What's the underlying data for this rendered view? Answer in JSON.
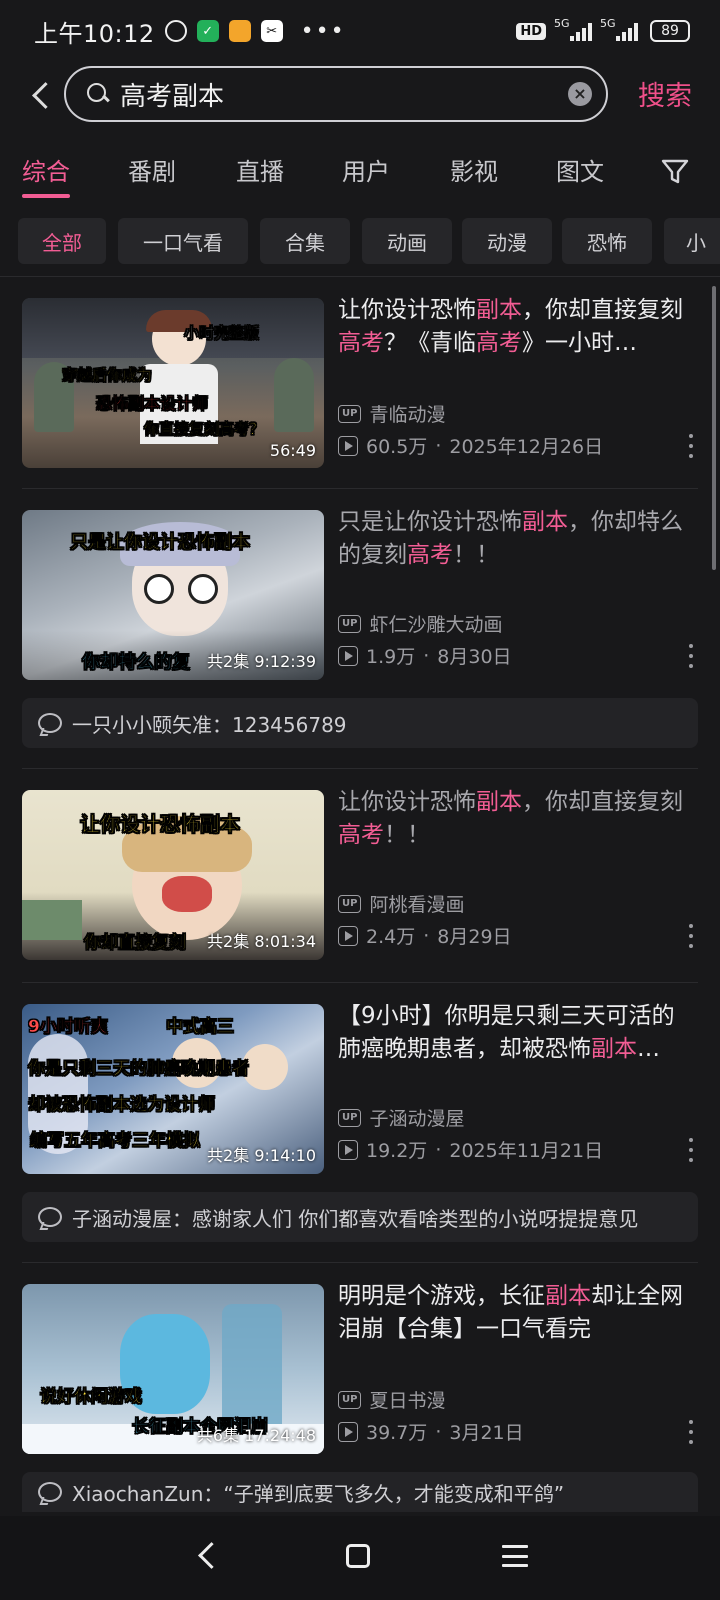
{
  "status_bar": {
    "time": "上午10:12",
    "battery": "89",
    "network_1": "5G",
    "network_2": "5G",
    "hd_badge": "HD",
    "icons": [
      "alarm-icon",
      "shield-app-icon",
      "notes-app-icon",
      "capcut-app-icon",
      "more-dots-icon",
      "signal-icon",
      "battery-icon"
    ]
  },
  "search": {
    "query": "高考副本",
    "search_button": "搜索"
  },
  "tabs": [
    {
      "label": "综合",
      "active": true
    },
    {
      "label": "番剧",
      "active": false
    },
    {
      "label": "直播",
      "active": false
    },
    {
      "label": "用户",
      "active": false
    },
    {
      "label": "影视",
      "active": false
    },
    {
      "label": "图文",
      "active": false
    }
  ],
  "chips": [
    {
      "label": "全部",
      "active": true
    },
    {
      "label": "一口气看",
      "active": false
    },
    {
      "label": "合集",
      "active": false
    },
    {
      "label": "动画",
      "active": false
    },
    {
      "label": "动漫",
      "active": false
    },
    {
      "label": "恐怖",
      "active": false
    },
    {
      "label": "小",
      "active": false
    }
  ],
  "accent_color": "#f25d94",
  "results": [
    {
      "title_parts": [
        {
          "t": "让你设计恐怖",
          "hl": false
        },
        {
          "t": "副本",
          "hl": true
        },
        {
          "t": "，你却直接复刻",
          "hl": false
        },
        {
          "t": "高考",
          "hl": true
        },
        {
          "t": "？《青临",
          "hl": false
        },
        {
          "t": "高考",
          "hl": true
        },
        {
          "t": "》一小时…",
          "hl": false
        }
      ],
      "watched": false,
      "uploader": "青临动漫",
      "views": "60.5万",
      "date": "2025年12月26日",
      "duration": "56:49",
      "episodes": "",
      "thumb_captions": [
        "小时完整版",
        "穿越后你成为",
        "恐怖副本设计师",
        "你直接复刻高考？"
      ],
      "comment": ""
    },
    {
      "title_parts": [
        {
          "t": "只是让你设计恐怖",
          "hl": false
        },
        {
          "t": "副本",
          "hl": true
        },
        {
          "t": "，你却特么的复刻",
          "hl": false
        },
        {
          "t": "高考",
          "hl": true
        },
        {
          "t": "！！",
          "hl": false
        }
      ],
      "watched": true,
      "uploader": "虾仁沙雕大动画",
      "views": "1.9万",
      "date": "8月30日",
      "duration": "9:12:39",
      "episodes": "共2集",
      "thumb_captions": [
        "只是让你设计恐怖副本",
        "你却特么的复"
      ],
      "comment": "一只小小颐矢准：123456789"
    },
    {
      "title_parts": [
        {
          "t": "让你设计恐怖",
          "hl": false
        },
        {
          "t": "副本",
          "hl": true
        },
        {
          "t": "，你却直接复刻",
          "hl": false
        },
        {
          "t": "高考",
          "hl": true
        },
        {
          "t": "！！",
          "hl": false
        }
      ],
      "watched": true,
      "uploader": "阿桃看漫画",
      "views": "2.4万",
      "date": "8月29日",
      "duration": "8:01:34",
      "episodes": "共2集",
      "thumb_captions": [
        "让你设计恐怖副本",
        "你却直接复刻"
      ],
      "comment": ""
    },
    {
      "title_parts": [
        {
          "t": "【9小时】你明是只剩三天可活的肺癌晚期患者，却被恐怖",
          "hl": false
        },
        {
          "t": "副本",
          "hl": true
        },
        {
          "t": "…",
          "hl": false
        }
      ],
      "watched": false,
      "uploader": "子涵动漫屋",
      "views": "19.2万",
      "date": "2025年11月21日",
      "duration": "9:14:10",
      "episodes": "共2集",
      "thumb_captions": [
        "9小时听爽",
        "中式高三",
        "你是只剩三天的肺癌晚期患者",
        "却被恐怖副本选为设计师",
        "编写五年高考三年模拟"
      ],
      "comment": "子涵动漫屋：感谢家人们 你们都喜欢看啥类型的小说呀提提意见"
    },
    {
      "title_parts": [
        {
          "t": "明明是个游戏，长征",
          "hl": false
        },
        {
          "t": "副本",
          "hl": true
        },
        {
          "t": "却让全网泪崩【合集】一口气看完",
          "hl": false
        }
      ],
      "watched": false,
      "uploader": "夏日书漫",
      "views": "39.7万",
      "date": "3月21日",
      "duration": "17:24:48",
      "episodes": "共6集",
      "thumb_captions": [
        "说好休闲游戏",
        "长征副本全网泪崩"
      ],
      "comment": "XiaochanZun：“子弹到底要飞多久，才能变成和平鸽”"
    }
  ]
}
